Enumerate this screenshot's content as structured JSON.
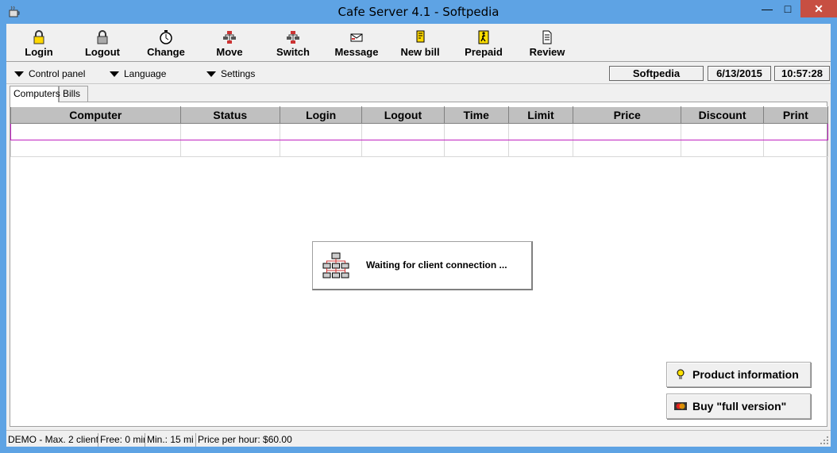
{
  "window": {
    "title": "Cafe Server 4.1 - Softpedia",
    "minimize": "—",
    "maximize": "□",
    "close": "✕"
  },
  "toolbar": {
    "buttons": [
      {
        "label": "Login",
        "icon": "lock-yellow-icon"
      },
      {
        "label": "Logout",
        "icon": "lock-icon"
      },
      {
        "label": "Change",
        "icon": "stopwatch-icon"
      },
      {
        "label": "Move",
        "icon": "network-move-icon"
      },
      {
        "label": "Switch",
        "icon": "network-switch-icon"
      },
      {
        "label": "Message",
        "icon": "envelope-icon"
      },
      {
        "label": "New bill",
        "icon": "bill-icon"
      },
      {
        "label": "Prepaid",
        "icon": "prepaid-person-icon"
      },
      {
        "label": "Review",
        "icon": "document-icon"
      }
    ]
  },
  "menu": {
    "items": [
      "Control panel",
      "Language",
      "Settings"
    ]
  },
  "info": {
    "name": "Softpedia",
    "date": "6/13/2015",
    "time": "10:57:28"
  },
  "tabs": [
    "Computers",
    "Bills"
  ],
  "table": {
    "columns": [
      "Computer",
      "Status",
      "Login",
      "Logout",
      "Time",
      "Limit",
      "Price",
      "Discount",
      "Print"
    ]
  },
  "waiting": {
    "text": "Waiting for client connection ..."
  },
  "side_buttons": {
    "product_info": "Product information",
    "buy": "Buy \"full version\""
  },
  "status": {
    "cells": [
      "DEMO - Max. 2 client",
      "Free: 0 mir",
      "Min.: 15 mi",
      "Price per hour: $60.00"
    ]
  },
  "colors": {
    "titlebar": "#5ea3e4",
    "close": "#c74f42",
    "selection_border": "#c020c0",
    "header_bg": "#c0c0c0"
  }
}
